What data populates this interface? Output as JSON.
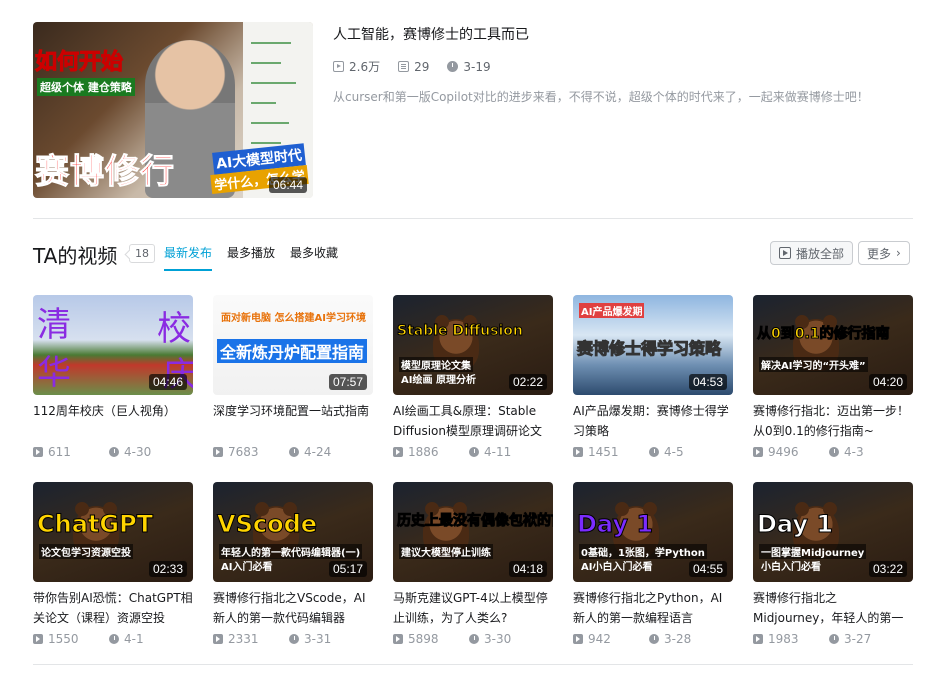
{
  "featured": {
    "title": "人工智能，赛博修士的工具而已",
    "views": "2.6万",
    "count": "29",
    "date": "3-19",
    "description": "从curser和第一版Copilot对比的进步来看，不得不说，超级个体的时代来了，一起来做赛博修士吧！",
    "duration": "06:44",
    "thumb_text": [
      "如何开始",
      "超级个体 建仓策略",
      "赛博修行",
      "AI大模型时代",
      "学什么，怎么学"
    ]
  },
  "section": {
    "title": "TA的视频",
    "count": "18",
    "tabs": [
      "最新发布",
      "最多播放",
      "最多收藏"
    ],
    "active_tab": 0,
    "play_all": "播放全部",
    "more": "更多"
  },
  "videos": [
    {
      "title": "112周年校庆（巨人视角）",
      "views": "611",
      "date": "4-30",
      "duration": "04:46",
      "thumb_text": [
        "清",
        "华",
        "校",
        "庆"
      ],
      "bg": "campus"
    },
    {
      "title": "深度学习环境配置一站式指南",
      "views": "7683",
      "date": "4-24",
      "duration": "07:57",
      "thumb_text": [
        "全新炼丹炉配置指南",
        "面对新电脑 怎么搭建AI学习环境"
      ],
      "bg": "white"
    },
    {
      "title": "AI绘画工具&原理：Stable Diffusion模型原理调研论文",
      "views": "1886",
      "date": "4-11",
      "duration": "02:22",
      "thumb_text": [
        "Stable Diffusion",
        "模型原理论文集",
        "AI绘画 原理分析"
      ],
      "bg": "bear"
    },
    {
      "title": "AI产品爆发期：赛博修士得学习策略",
      "views": "1451",
      "date": "4-5",
      "duration": "04:53",
      "thumb_text": [
        "赛博修士得学习策略",
        "AI产品爆发期"
      ],
      "bg": "city"
    },
    {
      "title": "赛博修行指北：迈出第一步！从0到0.1的修行指南~",
      "views": "9496",
      "date": "4-3",
      "duration": "04:20",
      "thumb_text": [
        "从0到0.1的修行指南",
        "解决AI学习的“开头难”"
      ],
      "bg": "bear"
    },
    {
      "title": "带你告别AI恐慌：ChatGPT相关论文（课程）资源空投",
      "views": "1550",
      "date": "4-1",
      "duration": "02:33",
      "thumb_text": [
        "ChatGPT",
        "论文包学习资源空投"
      ],
      "bg": "bear"
    },
    {
      "title": "赛博修行指北之VScode，AI新人的第一款代码编辑器",
      "views": "2331",
      "date": "3-31",
      "duration": "05:17",
      "thumb_text": [
        "VScode",
        "年轻人的第一款代码编辑器(一)",
        "AI入门必看"
      ],
      "bg": "bear"
    },
    {
      "title": "马斯克建议GPT-4以上模型停止训练，为了人类么?",
      "views": "5898",
      "date": "3-30",
      "duration": "04:18",
      "thumb_text": [
        "历史上最没有偶像包袱的首富",
        "建议大模型停止训练"
      ],
      "bg": "bear"
    },
    {
      "title": "赛博修行指北之Python，AI新人的第一款编程语言",
      "views": "942",
      "date": "3-28",
      "duration": "04:55",
      "thumb_text": [
        "Day 1",
        "0基础，1张图，学Python",
        "AI小白入门必看"
      ],
      "bg": "bear"
    },
    {
      "title": "赛博修行指北之Midjourney，年轻人的第一款AI绘画工具",
      "views": "1983",
      "date": "3-27",
      "duration": "03:22",
      "thumb_text": [
        "Day 1",
        "一图掌握Midjourney",
        "小白入门必看"
      ],
      "bg": "bear"
    }
  ],
  "colors": {
    "accent": "#00a1d6",
    "meta": "#9499a0"
  }
}
